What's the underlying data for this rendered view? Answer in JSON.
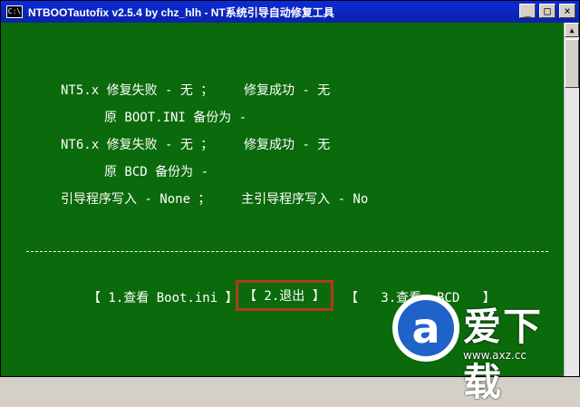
{
  "window": {
    "title": "NTBOOTautofix v2.5.4 by chz_hlh - NT系统引导自动修复工具",
    "icon_label": "C:\\",
    "controls": {
      "minimize": "_",
      "maximize": "□",
      "close": "×"
    }
  },
  "report": {
    "nt5_line": "NT5.x 修复失败 - 无 ；    修复成功 - 无",
    "nt5_backup": "原 BOOT.INI 备份为 -",
    "nt6_line": "NT6.x 修复失败 - 无 ；    修复成功 - 无",
    "nt6_backup": "原 BCD 备份为 -",
    "bootloader_line": "引导程序写入 - None ；    主引导程序写入 - No"
  },
  "menu": {
    "option1": "【 1.查看 Boot.ini 】",
    "option2": "【 2.退出 】",
    "option3": "【   3.查看  BCD   】"
  },
  "watermark": {
    "brand_text": "爱下载",
    "url": "www.axz.cc",
    "logo_glyph": "a"
  },
  "colors": {
    "console_bg": "#0b6a0b",
    "console_fg": "#ffffff",
    "selected_outline": "#b23a1a",
    "titlebar": "#0b2bd8"
  }
}
